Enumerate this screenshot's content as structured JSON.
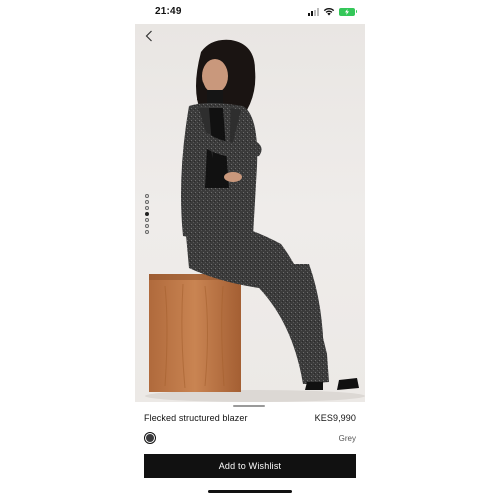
{
  "status_bar": {
    "time": "21:49",
    "icons": [
      "signal-icon",
      "wifi-icon",
      "battery-charging-icon"
    ],
    "battery_color": "#34c759"
  },
  "gallery": {
    "back_icon": "chevron-left-icon",
    "image_count": 7,
    "active_index": 3
  },
  "product": {
    "name": "Flecked structured blazer",
    "price": "KES9,990",
    "color_name": "Grey",
    "swatch_color": "#3a3a3c"
  },
  "actions": {
    "wishlist_label": "Add to Wishlist"
  }
}
